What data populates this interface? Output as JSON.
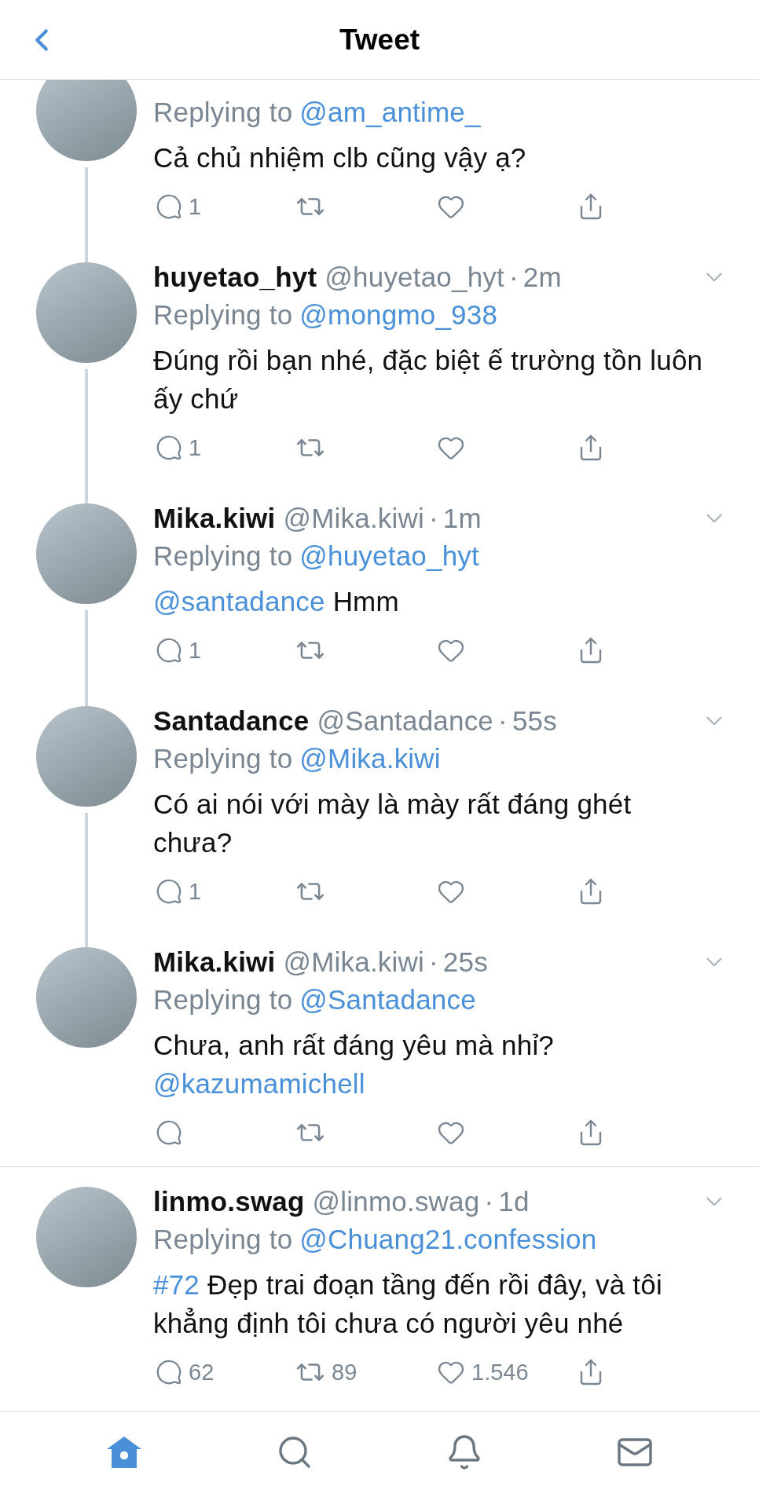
{
  "header": {
    "title": "Tweet"
  },
  "thread": [
    {
      "replying_prefix": "Replying to",
      "replying_to": "@am_antime_",
      "text": [
        {
          "kind": "plain",
          "text": "Cả chủ nhiệm clb cũng vậy ạ?"
        }
      ],
      "replies": "1",
      "thread_continues": true
    },
    {
      "name": "huyetao_hyt",
      "handle": "@huyetao_hyt",
      "separator": "·",
      "time": "2m",
      "replying_prefix": "Replying to",
      "replying_to": "@mongmo_938",
      "text": [
        {
          "kind": "plain",
          "text": "Đúng rồi bạn nhé, đặc biệt ế trường tồn luôn ấy chứ"
        }
      ],
      "replies": "1",
      "thread_continues": true
    },
    {
      "name": "Mika.kiwi",
      "handle": "@Mika.kiwi",
      "separator": "·",
      "time": "1m",
      "replying_prefix": "Replying to",
      "replying_to": "@huyetao_hyt",
      "text": [
        {
          "kind": "mention",
          "text": "@santadance"
        },
        {
          "kind": "plain",
          "text": " Hmm"
        }
      ],
      "replies": "1",
      "thread_continues": true
    },
    {
      "name": "Santadance",
      "handle": "@Santadance",
      "separator": "·",
      "time": "55s",
      "replying_prefix": "Replying to",
      "replying_to": "@Mika.kiwi",
      "text": [
        {
          "kind": "plain",
          "text": "Có ai nói với mày là mày rất đáng ghét chưa?"
        }
      ],
      "replies": "1",
      "thread_continues": true
    },
    {
      "name": "Mika.kiwi",
      "handle": "@Mika.kiwi",
      "separator": "·",
      "time": "25s",
      "replying_prefix": "Replying to",
      "replying_to": "@Santadance",
      "text": [
        {
          "kind": "plain",
          "text": "Chưa, anh rất đáng yêu mà nhỉ? "
        },
        {
          "kind": "mention",
          "text": "@kazumamichell"
        }
      ],
      "thread_continues": false
    }
  ],
  "other_replies": [
    {
      "name": "linmo.swag",
      "handle": "@linmo.swag",
      "separator": "·",
      "time": "1d",
      "replying_prefix": "Replying to",
      "replying_to": "@Chuang21.confession",
      "text": [
        {
          "kind": "mention",
          "text": "#72"
        },
        {
          "kind": "plain",
          "text": " Đẹp trai đoạn tầng đến rồi đây, và tôi khẳng định tôi chưa có người yêu nhé"
        }
      ],
      "replies": "62",
      "retweets": "89",
      "likes": "1.546",
      "thread_continues": false
    }
  ],
  "tab_bar": [
    {
      "kind": "home",
      "selected": true
    },
    {
      "kind": "search",
      "selected": false
    },
    {
      "kind": "notifications",
      "selected": false
    },
    {
      "kind": "messages",
      "selected": false
    }
  ]
}
